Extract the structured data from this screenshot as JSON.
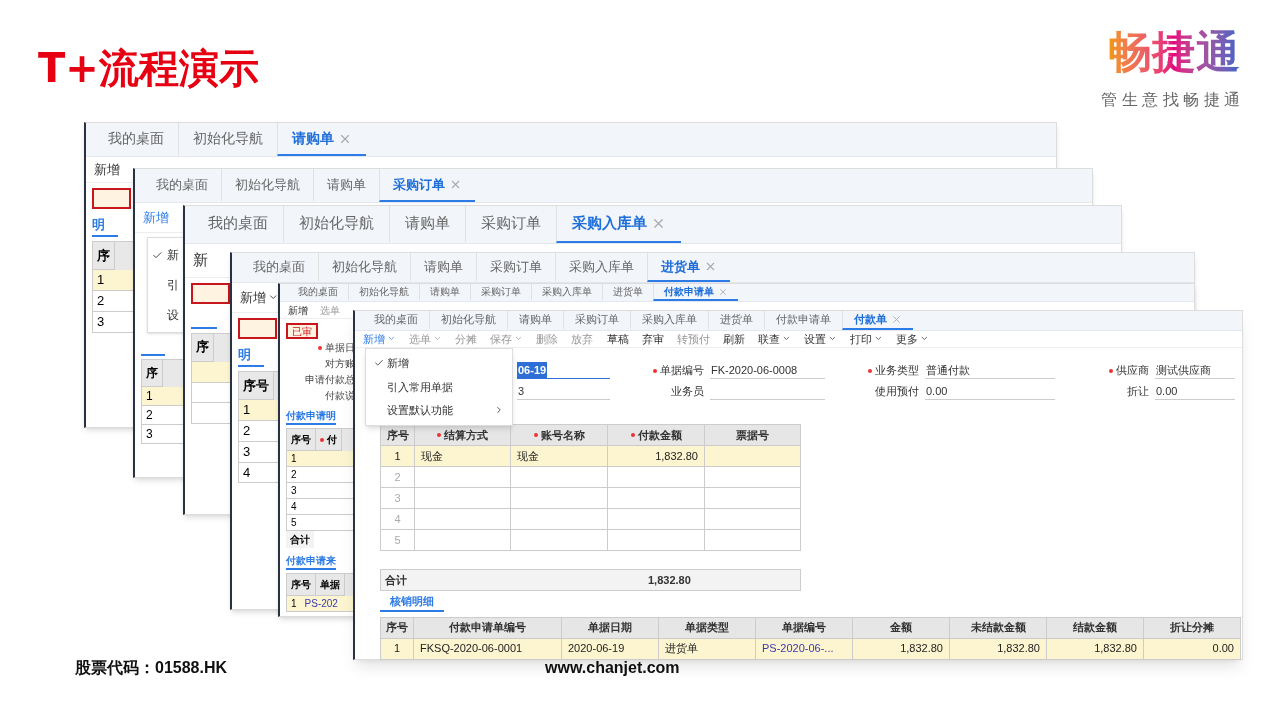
{
  "slide": {
    "title": "T+流程演示",
    "logo": {
      "name": "畅捷通",
      "slogan": "管 生 意 找 畅 捷 通"
    },
    "footer": {
      "stock_code": "股票代码：01588.HK",
      "website": "www.chanjet.com"
    }
  },
  "back_windows": [
    {
      "tabs": [
        {
          "label": "我的桌面",
          "selected": false,
          "closable": false
        },
        {
          "label": "初始化导航",
          "selected": false,
          "closable": false
        },
        {
          "label": "请购单",
          "selected": true,
          "closable": true
        }
      ],
      "toolbar": [
        {
          "label": "新增",
          "dropdown": false,
          "open": false,
          "disabled": false
        }
      ],
      "strip": [
        {
          "kind": "badge"
        },
        {
          "kind": "section",
          "text": "明"
        },
        {
          "kind": "table",
          "header": [
            {
              "text": "序",
              "required": false
            }
          ],
          "rows": [
            {
              "cells": [
                "1"
              ],
              "selected": true
            },
            {
              "cells": [
                "2"
              ],
              "selected": false
            },
            {
              "cells": [
                "3"
              ],
              "selected": false
            }
          ]
        }
      ]
    },
    {
      "tabs": [
        {
          "label": "我的桌面",
          "selected": false,
          "closable": false
        },
        {
          "label": "初始化导航",
          "selected": false,
          "closable": false
        },
        {
          "label": "请购单",
          "selected": false,
          "closable": false
        },
        {
          "label": "采购订单",
          "selected": true,
          "closable": true
        }
      ],
      "toolbar": [
        {
          "label": "新增",
          "dropdown": false,
          "open": true,
          "disabled": false
        }
      ],
      "strip": [
        {
          "kind": "menu",
          "items": [
            {
              "label": "新",
              "checked": true
            },
            {
              "label": "引",
              "checked": false
            },
            {
              "label": "设",
              "checked": false
            }
          ]
        },
        {
          "kind": "section"
        },
        {
          "kind": "table",
          "header": [
            {
              "text": "序",
              "required": false
            }
          ],
          "rows": [
            {
              "cells": [
                "1"
              ],
              "selected": true
            },
            {
              "cells": [
                "2"
              ],
              "selected": false
            },
            {
              "cells": [
                "3"
              ],
              "selected": false
            }
          ]
        }
      ]
    },
    {
      "tabs": [
        {
          "label": "我的桌面",
          "selected": false,
          "closable": false
        },
        {
          "label": "初始化导航",
          "selected": false,
          "closable": false
        },
        {
          "label": "请购单",
          "selected": false,
          "closable": false
        },
        {
          "label": "采购订单",
          "selected": false,
          "closable": false
        },
        {
          "label": "采购入库单",
          "selected": true,
          "closable": true
        }
      ],
      "toolbar": [
        {
          "label": "新",
          "dropdown": false,
          "open": false,
          "disabled": false
        }
      ],
      "strip": [
        {
          "kind": "badge"
        },
        {
          "kind": "section"
        },
        {
          "kind": "table",
          "header": [
            {
              "text": "序",
              "required": false
            }
          ],
          "rows": [
            {
              "cells": [],
              "selected": true
            },
            {
              "cells": [],
              "selected": false
            },
            {
              "cells": [],
              "selected": false
            }
          ]
        }
      ]
    },
    {
      "tabs": [
        {
          "label": "我的桌面",
          "selected": false,
          "closable": false
        },
        {
          "label": "初始化导航",
          "selected": false,
          "closable": false
        },
        {
          "label": "请购单",
          "selected": false,
          "closable": false
        },
        {
          "label": "采购订单",
          "selected": false,
          "closable": false
        },
        {
          "label": "采购入库单",
          "selected": false,
          "closable": false
        },
        {
          "label": "进货单",
          "selected": true,
          "closable": true
        }
      ],
      "toolbar": [
        {
          "label": "新增",
          "dropdown": true,
          "open": false,
          "disabled": false
        }
      ],
      "strip": [
        {
          "kind": "badge"
        },
        {
          "kind": "section",
          "text": "明"
        },
        {
          "kind": "table",
          "header": [
            {
              "text": "序号",
              "required": false
            }
          ],
          "rows": [
            {
              "cells": [
                "1"
              ],
              "selected": true
            },
            {
              "cells": [
                "2"
              ],
              "selected": false
            },
            {
              "cells": [
                "3"
              ],
              "selected": false
            },
            {
              "cells": [
                "4"
              ],
              "selected": false
            }
          ]
        }
      ]
    },
    {
      "tabs": [
        {
          "label": "我的桌面",
          "selected": false,
          "closable": false
        },
        {
          "label": "初始化导航",
          "selected": false,
          "closable": false
        },
        {
          "label": "请购单",
          "selected": false,
          "closable": false
        },
        {
          "label": "采购订单",
          "selected": false,
          "closable": false
        },
        {
          "label": "采购入库单",
          "selected": false,
          "closable": false
        },
        {
          "label": "进货单",
          "selected": false,
          "closable": false
        },
        {
          "label": "付款申请单",
          "selected": true,
          "closable": true
        }
      ],
      "toolbar": [
        {
          "label": "新增",
          "dropdown": false,
          "open": false,
          "disabled": false
        },
        {
          "label": "选单",
          "dropdown": false,
          "open": false,
          "disabled": true
        }
      ],
      "strip": [
        {
          "kind": "badge",
          "text": "已审"
        },
        {
          "kind": "label",
          "text": "单据日",
          "required": true
        },
        {
          "kind": "label",
          "text": "对方账",
          "required": false
        },
        {
          "kind": "label",
          "text": "申请付款总",
          "required": false
        },
        {
          "kind": "label",
          "text": "付款说",
          "required": false
        },
        {
          "kind": "section",
          "text": "付款申请明"
        },
        {
          "kind": "table",
          "header": [
            {
              "text": "序号",
              "required": false
            },
            {
              "text": "付",
              "required": true
            }
          ],
          "rows": [
            {
              "cells": [
                "1"
              ],
              "selected": true
            },
            {
              "cells": [
                "2"
              ],
              "selected": false
            },
            {
              "cells": [
                "3"
              ],
              "selected": false
            },
            {
              "cells": [
                "4"
              ],
              "selected": false
            },
            {
              "cells": [
                "5"
              ],
              "selected": false
            }
          ]
        },
        {
          "kind": "total",
          "text": "合计"
        },
        {
          "kind": "section",
          "text": "付款申请来"
        },
        {
          "kind": "table",
          "header": [
            {
              "text": "序号",
              "required": false
            },
            {
              "text": "单据",
              "required": false
            }
          ],
          "rows": [
            {
              "cells": [
                "1",
                "PS-202"
              ],
              "selected": true
            }
          ]
        }
      ]
    }
  ],
  "main_window": {
    "tabs": [
      {
        "label": "我的桌面",
        "selected": false,
        "closable": false
      },
      {
        "label": "初始化导航",
        "selected": false,
        "closable": false
      },
      {
        "label": "请购单",
        "selected": false,
        "closable": false
      },
      {
        "label": "采购订单",
        "selected": false,
        "closable": false
      },
      {
        "label": "采购入库单",
        "selected": false,
        "closable": false
      },
      {
        "label": "进货单",
        "selected": false,
        "closable": false
      },
      {
        "label": "付款申请单",
        "selected": false,
        "closable": false
      },
      {
        "label": "付款单",
        "selected": true,
        "closable": true
      }
    ],
    "toolbar": [
      {
        "label": "新增",
        "dropdown": true,
        "open": true,
        "disabled": false
      },
      {
        "label": "选单",
        "dropdown": true,
        "open": false,
        "disabled": true
      },
      {
        "label": "分摊",
        "dropdown": false,
        "open": false,
        "disabled": true
      },
      {
        "label": "保存",
        "dropdown": true,
        "open": false,
        "disabled": true
      },
      {
        "label": "删除",
        "dropdown": false,
        "open": false,
        "disabled": true
      },
      {
        "label": "放弃",
        "dropdown": false,
        "open": false,
        "disabled": true
      },
      {
        "label": "草稿",
        "dropdown": false,
        "open": false,
        "disabled": false
      },
      {
        "label": "弃审",
        "dropdown": false,
        "open": false,
        "disabled": false
      },
      {
        "label": "转预付",
        "dropdown": false,
        "open": false,
        "disabled": true
      },
      {
        "label": "刷新",
        "dropdown": false,
        "open": false,
        "disabled": false
      },
      {
        "label": "联查",
        "dropdown": true,
        "open": false,
        "disabled": false
      },
      {
        "label": "设置",
        "dropdown": true,
        "open": false,
        "disabled": false
      },
      {
        "label": "打印",
        "dropdown": true,
        "open": false,
        "disabled": false
      },
      {
        "label": "更多",
        "dropdown": true,
        "open": false,
        "disabled": false
      }
    ],
    "menu": [
      {
        "label": "新增",
        "checked": true,
        "submenu": false
      },
      {
        "label": "引入常用单据",
        "checked": false,
        "submenu": false
      },
      {
        "label": "设置默认功能",
        "checked": false,
        "submenu": true
      }
    ],
    "fields": [
      {
        "value": "06-19",
        "highlighted": true
      },
      {
        "label": "单据编号",
        "value": "FK-2020-06-0008",
        "required": true,
        "highlighted": false
      },
      {
        "label": "业务类型",
        "value": "普通付款",
        "required": true,
        "highlighted": false
      },
      {
        "label": "供应商",
        "value": "测试供应商",
        "required": true,
        "highlighted": false
      },
      {
        "value": "3",
        "highlighted": false
      },
      {
        "label": "业务员",
        "required": false,
        "highlighted": false
      },
      {
        "label": "使用预付",
        "value": "0.00",
        "required": false,
        "highlighted": false
      },
      {
        "label": "折让",
        "value": "0.00",
        "required": false,
        "highlighted": false
      }
    ],
    "payment_table": {
      "columns": [
        {
          "text": "序号",
          "required": false,
          "kind": "index"
        },
        {
          "text": "结算方式",
          "required": true,
          "kind": "text"
        },
        {
          "text": "账号名称",
          "required": true,
          "kind": "text"
        },
        {
          "text": "付款金额",
          "required": true,
          "kind": "number"
        },
        {
          "text": "票据号",
          "required": false,
          "kind": "text"
        }
      ],
      "rows": [
        {
          "cells": [
            "1",
            "现金",
            "现金",
            "1,832.80"
          ],
          "selected": true
        },
        {
          "cells": [
            "2"
          ],
          "selected": false
        },
        {
          "cells": [
            "3"
          ],
          "selected": false
        },
        {
          "cells": [
            "4"
          ],
          "selected": false
        },
        {
          "cells": [
            "5"
          ],
          "selected": false
        }
      ]
    },
    "total": {
      "label": "合计",
      "amount": "1,832.80"
    },
    "section_tab": "核销明细",
    "writeoff_table": {
      "columns": [
        {
          "text": "序号",
          "required": false,
          "kind": "index"
        },
        {
          "text": "付款申请单编号",
          "required": false,
          "kind": "text"
        },
        {
          "text": "单据日期",
          "required": false,
          "kind": "text"
        },
        {
          "text": "单据类型",
          "required": false,
          "kind": "text"
        },
        {
          "text": "单据编号",
          "required": false,
          "kind": "link"
        },
        {
          "text": "金额",
          "required": false,
          "kind": "number"
        },
        {
          "text": "未结款金额",
          "required": false,
          "kind": "number"
        },
        {
          "text": "结款金额",
          "required": false,
          "kind": "number"
        },
        {
          "text": "折让分摊",
          "required": false,
          "kind": "number"
        }
      ],
      "rows": [
        {
          "cells": [
            "1",
            "FKSQ-2020-06-0001",
            "2020-06-19",
            "进货单",
            "PS-2020-06-...",
            "1,832.80",
            "1,832.80",
            "1,832.80",
            "0.00"
          ],
          "selected": true
        }
      ]
    }
  }
}
